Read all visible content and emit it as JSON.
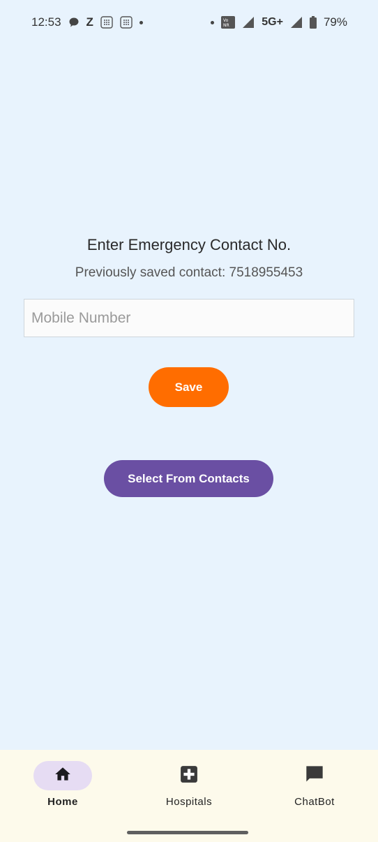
{
  "status_bar": {
    "time": "12:53",
    "z_label": "Z",
    "network": "5G+",
    "battery": "79%",
    "icons": [
      "chat-bubble-icon",
      "z-icon",
      "grid-icon",
      "grid-icon",
      "dot-icon",
      "dot-icon",
      "volte-icon",
      "signal-icon",
      "signal-icon",
      "battery-icon"
    ]
  },
  "main": {
    "title": "Enter Emergency Contact No.",
    "previous_contact": "Previously saved contact: 7518955453",
    "mobile_input": {
      "value": "",
      "placeholder": "Mobile Number"
    },
    "save_label": "Save",
    "select_contacts_label": "Select From Contacts"
  },
  "colors": {
    "background": "#e8f3fd",
    "save_button": "#ff6d00",
    "contacts_button": "#6a4fa3",
    "nav_background": "#fdfaeb",
    "nav_active_pill": "#e6dcf3"
  },
  "bottom_nav": {
    "items": [
      {
        "label": "Home",
        "icon": "home-icon",
        "active": true
      },
      {
        "label": "Hospitals",
        "icon": "medical-cross-icon",
        "active": false
      },
      {
        "label": "ChatBot",
        "icon": "chat-icon",
        "active": false
      }
    ]
  }
}
